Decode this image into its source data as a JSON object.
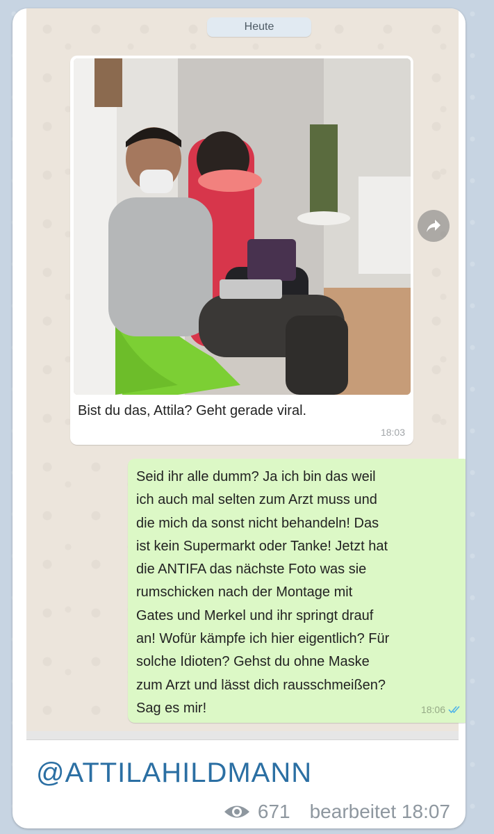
{
  "chat": {
    "date_label": "Heute",
    "incoming": {
      "text": "Bist du das, Attila? Geht gerade viral.",
      "time": "18:03"
    },
    "outgoing": {
      "text": "Seid ihr alle dumm? Ja ich bin das weil\nich auch mal selten zum Arzt muss und\ndie mich da sonst nicht behandeln! Das\nist kein Supermarkt oder Tanke! Jetzt hat\ndie ANTIFA das nächste Foto was sie\nrumschicken nach der Montage mit\nGates und Merkel und ihr springt drauf\nan! Wofür kämpfe ich hier eigentlich? Für\nsolche Idioten? Gehst du ohne Maske\nzum Arzt und lässt dich rausschmeißen?\nSag es mir!",
      "time": "18:06",
      "status_icon": "double-check-icon"
    }
  },
  "post": {
    "handle": "@ATTILAHILDMANN",
    "views": "671",
    "edited_label": "bearbeitet 18:07"
  },
  "colors": {
    "incoming_bubble": "#ffffff",
    "outgoing_bubble": "#dcf8c6",
    "chat_background": "#ece5dc",
    "handle_blue": "#2b6fa3",
    "check_blue": "#4fb3e8"
  }
}
